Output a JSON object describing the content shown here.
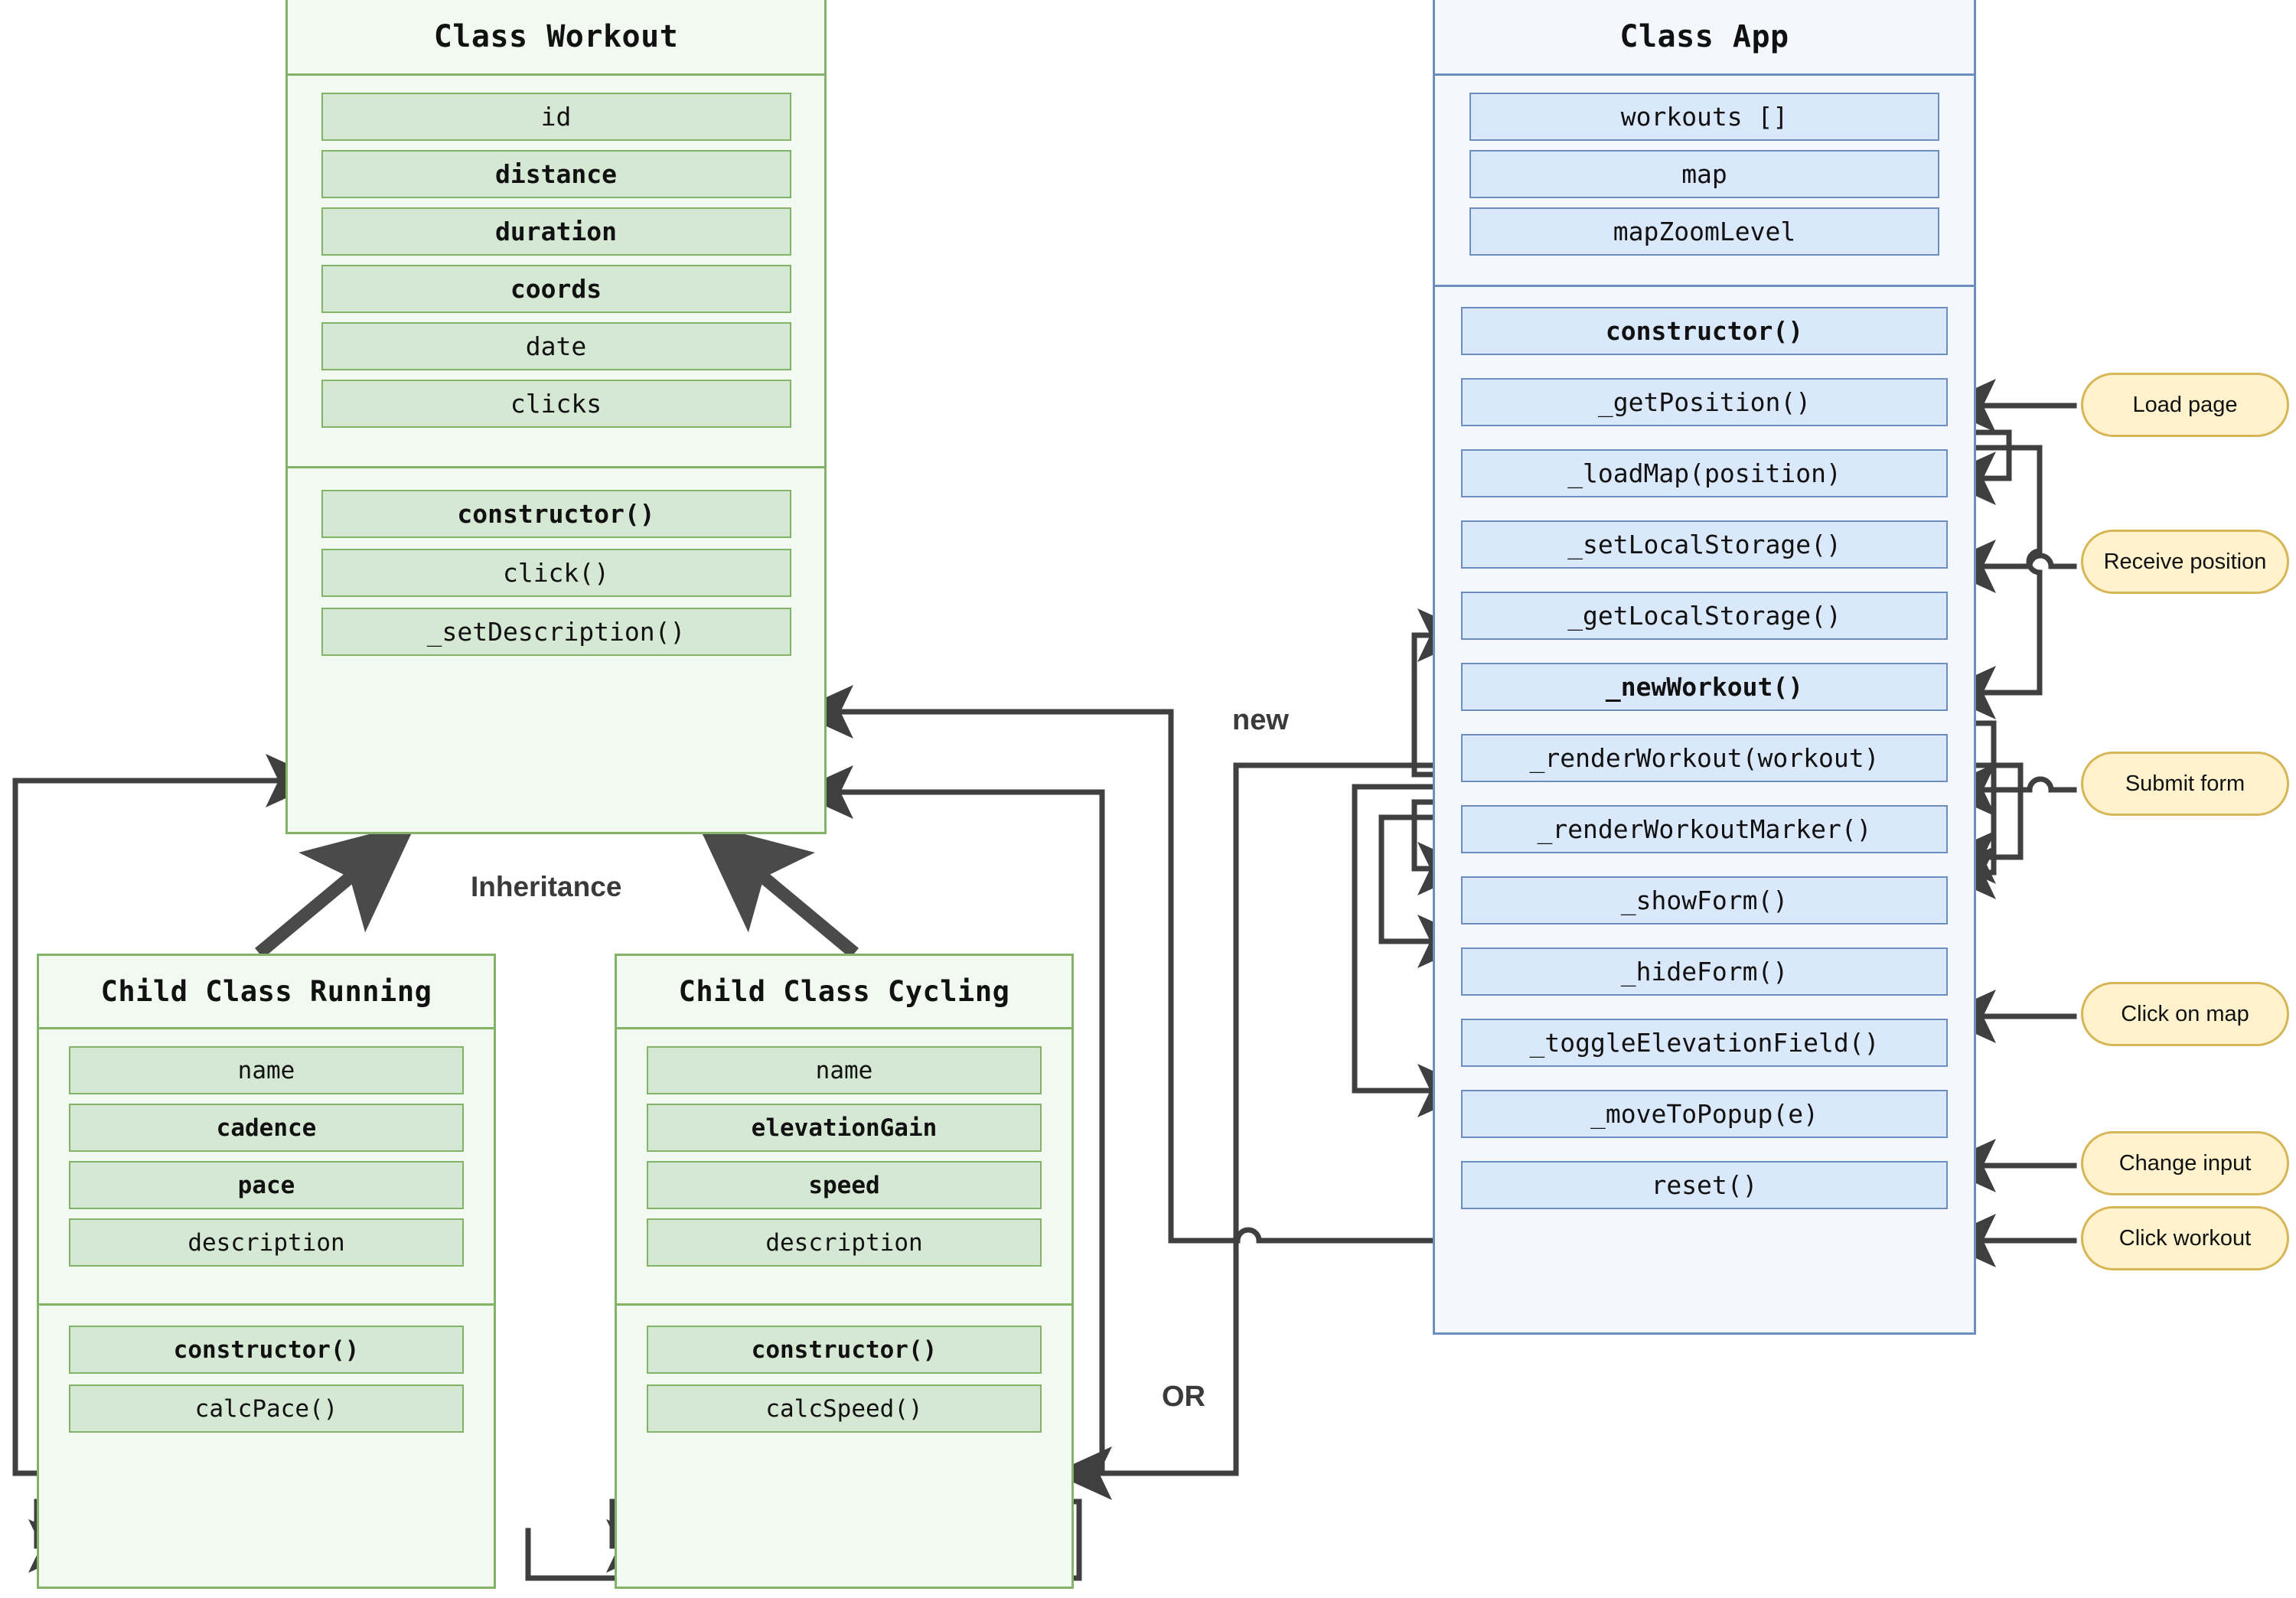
{
  "diagram": {
    "title_note": "Mapty application class architecture diagram",
    "colors": {
      "green_fill": "#d5e8d4",
      "green_border": "#82b366",
      "green_panel": "#f2f9f1",
      "blue_fill": "#dae8fc",
      "blue_border": "#6c8ebf",
      "blue_panel": "#f4f8fe",
      "event_fill": "#fff2cc",
      "event_border": "#d6b656",
      "connector": "#3f3f3f"
    }
  },
  "workout_class": {
    "title": "Class Workout",
    "properties": [
      {
        "label": "id",
        "bold": false
      },
      {
        "label": "distance",
        "bold": true
      },
      {
        "label": "duration",
        "bold": true
      },
      {
        "label": "coords",
        "bold": true
      },
      {
        "label": "date",
        "bold": false
      },
      {
        "label": "clicks",
        "bold": false
      }
    ],
    "methods": [
      {
        "label": "constructor()",
        "bold": true
      },
      {
        "label": "click()",
        "bold": false
      },
      {
        "label": "_setDescription()",
        "bold": false
      }
    ]
  },
  "running_class": {
    "title": "Child Class Running",
    "properties": [
      {
        "label": "name",
        "bold": false
      },
      {
        "label": "cadence",
        "bold": true
      },
      {
        "label": "pace",
        "bold": true
      },
      {
        "label": "description",
        "bold": false
      }
    ],
    "methods": [
      {
        "label": "constructor()",
        "bold": true
      },
      {
        "label": "calcPace()",
        "bold": false
      }
    ]
  },
  "cycling_class": {
    "title": "Child Class Cycling",
    "properties": [
      {
        "label": "name",
        "bold": false
      },
      {
        "label": "elevationGain",
        "bold": true
      },
      {
        "label": "speed",
        "bold": true
      },
      {
        "label": "description",
        "bold": false
      }
    ],
    "methods": [
      {
        "label": "constructor()",
        "bold": true
      },
      {
        "label": "calcSpeed()",
        "bold": false
      }
    ]
  },
  "app_class": {
    "title": "Class App",
    "properties": [
      {
        "label": "workouts []",
        "bold": false
      },
      {
        "label": "map",
        "bold": false
      },
      {
        "label": "mapZoomLevel",
        "bold": false
      }
    ],
    "methods": [
      {
        "label": "constructor()",
        "bold": true
      },
      {
        "label": "_getPosition()",
        "bold": false
      },
      {
        "label": "_loadMap(position)",
        "bold": false
      },
      {
        "label": "_setLocalStorage()",
        "bold": false
      },
      {
        "label": "_getLocalStorage()",
        "bold": false
      },
      {
        "label": "_newWorkout()",
        "bold": true
      },
      {
        "label": "_renderWorkout(workout)",
        "bold": false
      },
      {
        "label": "_renderWorkoutMarker()",
        "bold": false
      },
      {
        "label": "_showForm()",
        "bold": false
      },
      {
        "label": "_hideForm()",
        "bold": false
      },
      {
        "label": "_toggleElevationField()",
        "bold": false
      },
      {
        "label": "_moveToPopup(e)",
        "bold": false
      },
      {
        "label": "reset()",
        "bold": false
      }
    ]
  },
  "events": [
    {
      "label": "Load page"
    },
    {
      "label": "Receive position"
    },
    {
      "label": "Submit form"
    },
    {
      "label": "Click on map"
    },
    {
      "label": "Change input"
    },
    {
      "label": "Click workout"
    }
  ],
  "edge_labels": {
    "inheritance": "Inheritance",
    "new": "new",
    "or": "OR"
  }
}
